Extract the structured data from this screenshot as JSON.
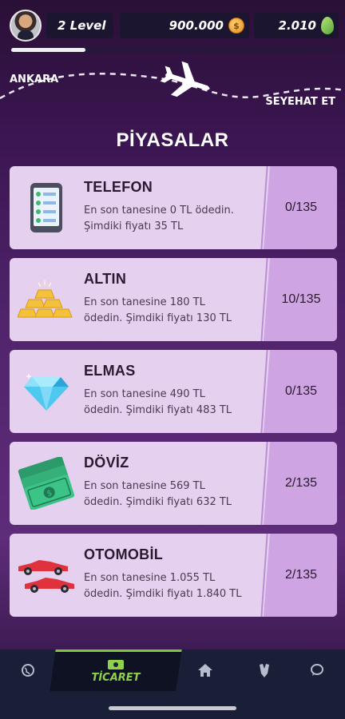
{
  "header": {
    "level_text": "2 Level",
    "coins": "900.000",
    "gems": "2.010",
    "xp_progress": 0.23
  },
  "route": {
    "from_city": "ANKARA",
    "travel_label": "SEYEHAT ET"
  },
  "section_title": "PİYASALAR",
  "items": [
    {
      "name": "TELEFON",
      "line1": "En son tanesine 0 TL ödedin.",
      "line2": "Şimdiki fiyatı 35 TL",
      "stock": "0/135",
      "icon": "phone-icon"
    },
    {
      "name": "ALTIN",
      "line1": "En son tanesine 180 TL",
      "line2": "ödedin. Şimdiki fiyatı 130 TL",
      "stock": "10/135",
      "icon": "gold-bars-icon"
    },
    {
      "name": "ELMAS",
      "line1": "En son tanesine 490 TL",
      "line2": "ödedin. Şimdiki fiyatı 483 TL",
      "stock": "0/135",
      "icon": "diamond-icon"
    },
    {
      "name": "DÖVİZ",
      "line1": "En son tanesine 569 TL",
      "line2": "ödedin. Şimdiki fiyatı 632 TL",
      "stock": "2/135",
      "icon": "money-stack-icon"
    },
    {
      "name": "OTOMOBİL",
      "line1": "En son tanesine 1.055 TL",
      "line2": "ödedin. Şimdiki fiyatı 1.840 TL",
      "stock": "2/135",
      "icon": "cars-icon"
    }
  ],
  "navbar": {
    "active_label": "TİCARET",
    "items": [
      "globe-icon",
      "cash-icon",
      "home-icon",
      "shield-icon",
      "chat-icon"
    ]
  },
  "colors": {
    "accent_green": "#8fd24a",
    "card_bg": "#e5d0ef",
    "card_stock_bg": "#cea5e2",
    "nav_bg": "#1a1f38"
  }
}
